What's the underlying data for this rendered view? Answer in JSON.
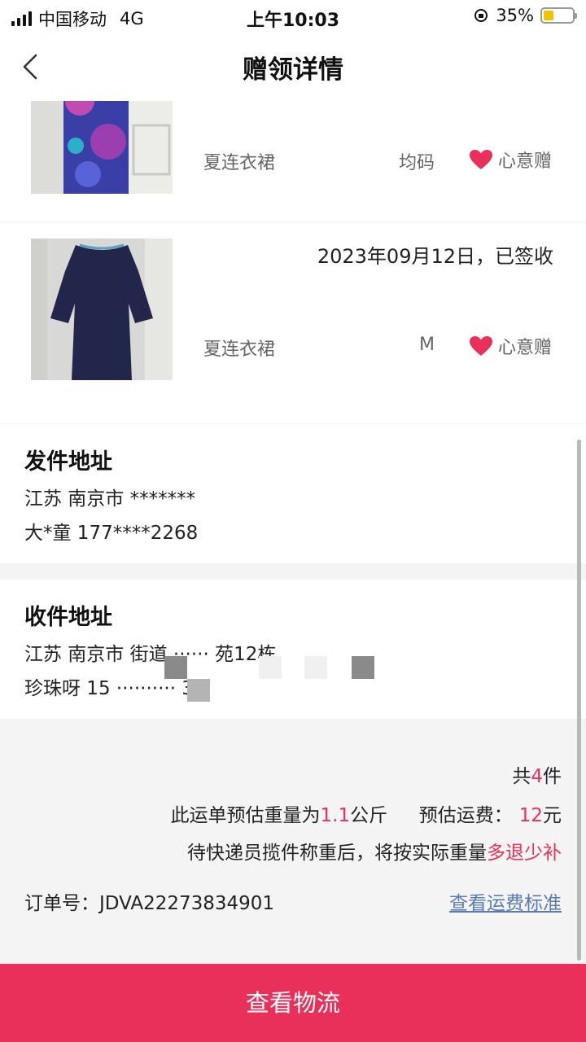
{
  "status_bar": {
    "carrier": "中国移动",
    "network": "4G",
    "time": "上午10:03",
    "battery": "35%",
    "battery_level": 0.35
  },
  "nav": {
    "title": "赠领详情",
    "back_icon": "chevron-left-icon"
  },
  "items": [
    {
      "name": "夏连衣裙",
      "size": "均码",
      "gift_label": "心意赠",
      "status": ""
    },
    {
      "name": "夏连衣裙",
      "size": "M",
      "gift_label": "心意赠",
      "status": "2023年09月12日，已签收"
    }
  ],
  "sender": {
    "title": "发件地址",
    "address": "江苏 南京市 *******",
    "contact": "大*童 177****2268"
  },
  "receiver": {
    "title": "收件地址",
    "address_visible": "江苏 南京市     街道 ······ 苑12栋",
    "contact_visible": "珍珠呀 15 ·········· 30"
  },
  "summary": {
    "count_prefix": "共",
    "count": "4",
    "count_suffix": "件",
    "weight_prefix": "此运单预估重量为",
    "weight": "1.1",
    "weight_unit": "公斤",
    "fee_prefix": "预估运费：",
    "fee": "12",
    "fee_unit": "元",
    "notice_prefix": "待快递员揽件称重后，将按实际重量",
    "notice_highlight": "多退少补",
    "order_label": "订单号：",
    "order_no": "JDVA22273834901",
    "fee_link": "查看运费标准"
  },
  "action": {
    "logistics_button": "查看物流"
  },
  "colors": {
    "accent": "#e8305a",
    "link": "#5a7bb6"
  }
}
